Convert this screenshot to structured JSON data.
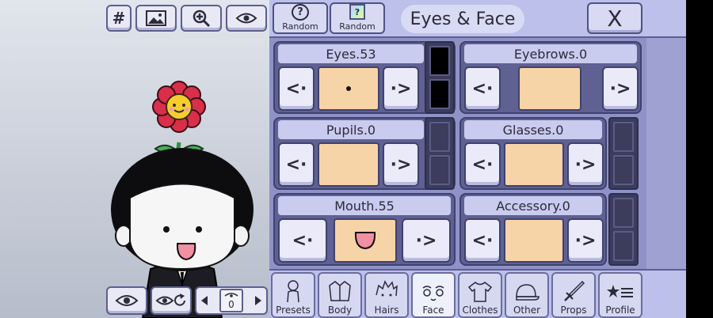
{
  "stage": {
    "toolbar": [
      {
        "id": "grid",
        "icon": "hash-icon",
        "glyph": "#"
      },
      {
        "id": "background",
        "icon": "image-icon"
      },
      {
        "id": "zoom",
        "icon": "zoom-in-icon"
      },
      {
        "id": "visibility",
        "icon": "eye-icon"
      }
    ],
    "frame_number": "0"
  },
  "header": {
    "random_1_label": "Random",
    "random_1_glyph": "?",
    "random_2_label": "Random",
    "random_2_glyph": "?",
    "title": "Eyes & Face",
    "close_label": "X"
  },
  "parts": [
    {
      "label": "Eyes.53"
    },
    {
      "label": "Eyebrows.0"
    },
    {
      "label": "Pupils.0"
    },
    {
      "label": "Glasses.0"
    },
    {
      "label": "Mouth.55"
    },
    {
      "label": "Accessory.0"
    }
  ],
  "arrows": {
    "prev": "<·",
    "next": "·>"
  },
  "tabs": [
    {
      "label": "Presets",
      "icon": "body-outline-icon"
    },
    {
      "label": "Body",
      "icon": "jacket-icon"
    },
    {
      "label": "Hairs",
      "icon": "hair-icon"
    },
    {
      "label": "Face",
      "icon": "face-icon",
      "active": true
    },
    {
      "label": "Clothes",
      "icon": "shirt-icon"
    },
    {
      "label": "Other",
      "icon": "cap-icon"
    },
    {
      "label": "Props",
      "icon": "sword-icon"
    },
    {
      "label": "Profile",
      "icon": "star-list-icon"
    }
  ],
  "colors": {
    "panel": "#8f92c6",
    "swatch": "#f7d3a8",
    "card": "#5f6192",
    "eye_color_slot": "#000000"
  }
}
